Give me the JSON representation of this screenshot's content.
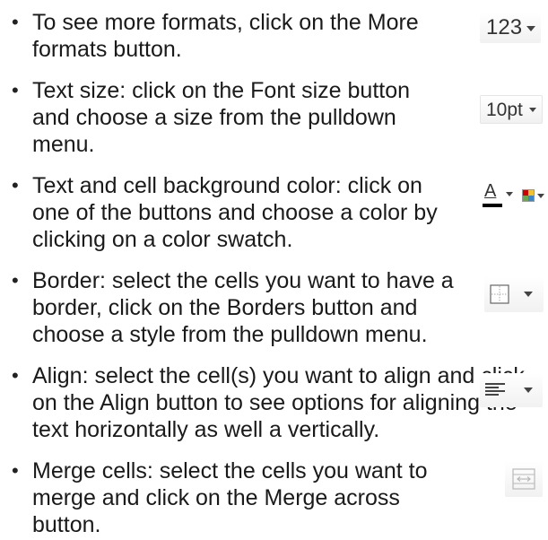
{
  "items": [
    {
      "text": "To see more formats, click on the More formats button.",
      "button": {
        "label": "123",
        "icon": "caret-down-icon"
      }
    },
    {
      "text": "Text size: click on the Font size button and choose a size from the pulldown menu.",
      "button": {
        "label": "10pt",
        "icon": "caret-down-icon"
      }
    },
    {
      "text": "Text and cell background color: click on one of the buttons and choose a color by clicking on a color swatch.",
      "button": {
        "label": "A",
        "icon": "text-color-icon",
        "second_icon": "cell-color-icon"
      }
    },
    {
      "text": "Border: select the cells you want to have a border, click on the Borders button and choose a style from the pulldown menu.",
      "button": {
        "icon": "borders-icon"
      }
    },
    {
      "text": "Align: select the cell(s) you want to align and click on the Align button to see options for aligning the text horizontally as well a vertically.",
      "button": {
        "icon": "align-left-icon"
      }
    },
    {
      "text": "Merge cells: select the cells you want to merge and click on the Merge across button.",
      "button": {
        "icon": "merge-cells-icon"
      }
    }
  ],
  "colors": {
    "text_color_underline": "#000000",
    "cell_color_red": "#cc0000",
    "cell_color_yellow": "#f1c232",
    "cell_color_green": "#6aa84f",
    "cell_color_blue": "#3d85c6",
    "icon_gray": "#555555",
    "disabled_gray": "#b8b8b8"
  }
}
